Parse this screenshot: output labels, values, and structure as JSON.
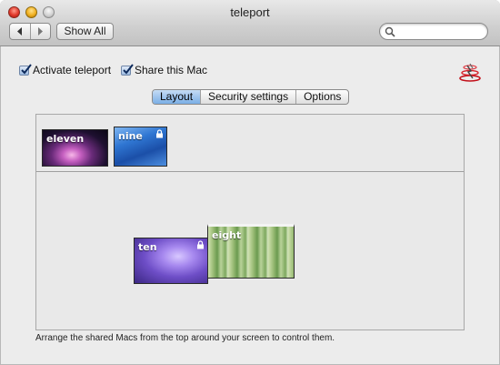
{
  "window": {
    "title": "teleport"
  },
  "toolbar": {
    "back_icon": "chevron-left-icon",
    "forward_icon": "chevron-right-icon",
    "show_all_label": "Show All",
    "search_placeholder": "",
    "search_icon": "magnifier-icon"
  },
  "options": {
    "activate": {
      "label": "Activate teleport",
      "checked": true
    },
    "share": {
      "label": "Share this Mac",
      "checked": true
    },
    "app_icon": "teleport-app-icon"
  },
  "tabs": [
    {
      "label": "Layout",
      "active": true
    },
    {
      "label": "Security settings",
      "active": false
    },
    {
      "label": "Options",
      "active": false
    }
  ],
  "layout": {
    "shared_macs": [
      {
        "name": "eleven",
        "locked": false
      },
      {
        "name": "nine",
        "locked": true
      }
    ],
    "arranged_macs": [
      {
        "name": "ten",
        "locked": true
      },
      {
        "name": "eight",
        "locked": false
      }
    ],
    "caption": "Arrange the shared Macs from the top around your screen to control them."
  },
  "colors": {
    "tab_active": "#7aaee6",
    "checkbox": "#9fbde2"
  }
}
